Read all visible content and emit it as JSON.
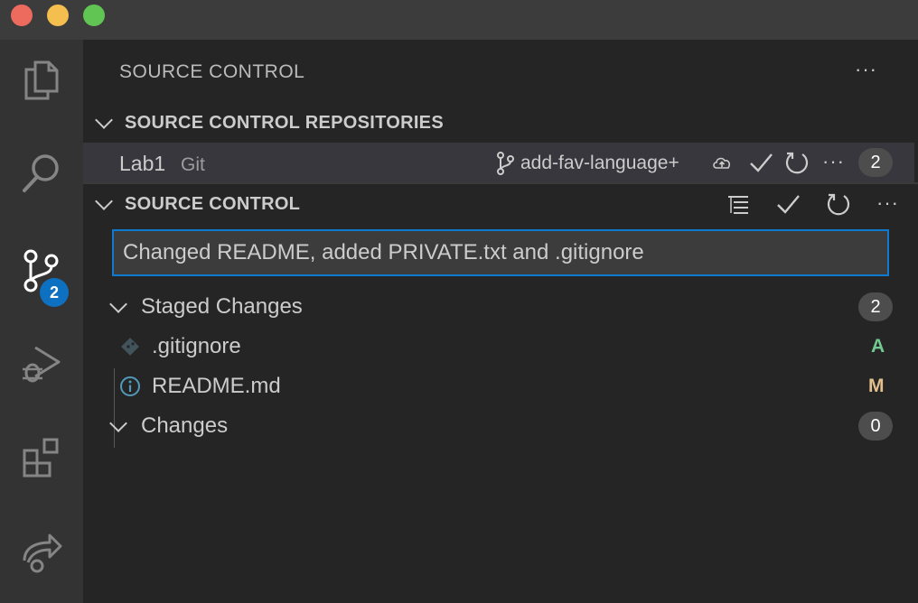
{
  "window": {
    "controls": [
      "close",
      "minimize",
      "maximize"
    ]
  },
  "activity_bar": {
    "items": [
      {
        "icon": "files-icon",
        "label": "Explorer"
      },
      {
        "icon": "search-icon",
        "label": "Search"
      },
      {
        "icon": "source-control-icon",
        "label": "Source Control",
        "badge": "2"
      },
      {
        "icon": "run-debug-icon",
        "label": "Run and Debug"
      },
      {
        "icon": "extensions-icon",
        "label": "Extensions"
      },
      {
        "icon": "live-share-icon",
        "label": "Live Share"
      }
    ]
  },
  "sidebar": {
    "title": "SOURCE CONTROL",
    "more_icon": "···",
    "repositories": {
      "header": "SOURCE CONTROL REPOSITORIES",
      "repo": {
        "name": "Lab1",
        "type": "Git",
        "branch": "add-fav-language+",
        "count": "2"
      }
    },
    "source_control": {
      "header": "SOURCE CONTROL",
      "commit_message": "Changed README, added PRIVATE.txt and .gitignore",
      "staged": {
        "label": "Staged Changes",
        "count": "2",
        "files": [
          {
            "name": ".gitignore",
            "icon": "git-file-icon",
            "status": "A",
            "status_color": "#73c991"
          },
          {
            "name": "README.md",
            "icon": "info-icon",
            "status": "M",
            "status_color": "#e2c08d"
          }
        ]
      },
      "changes": {
        "label": "Changes",
        "count": "0"
      }
    }
  },
  "colors": {
    "accent": "#0e70c0",
    "focus_border": "#0e7ad1",
    "added": "#73c991",
    "modified": "#e2c08d"
  }
}
